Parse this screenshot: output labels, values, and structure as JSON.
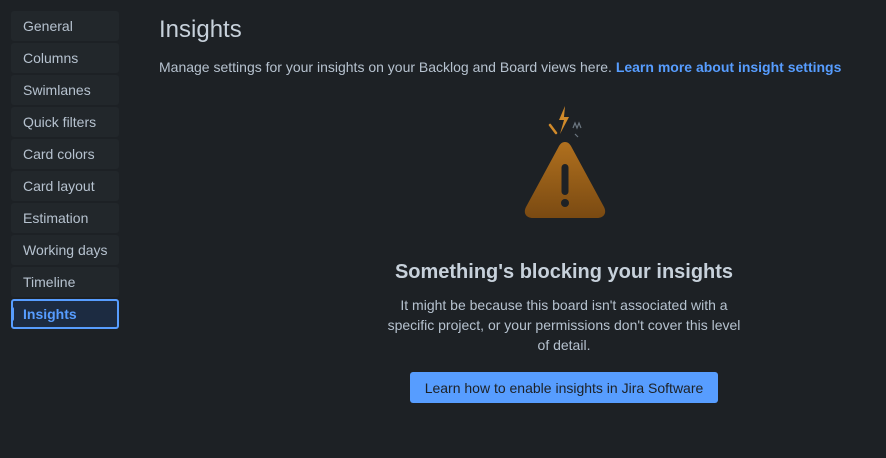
{
  "sidebar": {
    "items": [
      {
        "label": "General"
      },
      {
        "label": "Columns"
      },
      {
        "label": "Swimlanes"
      },
      {
        "label": "Quick filters"
      },
      {
        "label": "Card colors"
      },
      {
        "label": "Card layout"
      },
      {
        "label": "Estimation"
      },
      {
        "label": "Working days"
      },
      {
        "label": "Timeline"
      },
      {
        "label": "Insights"
      }
    ],
    "active": "Insights"
  },
  "header": {
    "title": "Insights",
    "description": "Manage settings for your insights on your Backlog and Board views here.",
    "link_label": "Learn more about insight settings"
  },
  "empty_state": {
    "icon": "warning-icon",
    "title": "Something's blocking your insights",
    "body": "It might be because this board isn't associated with a specific project, or your permissions don't cover this level of detail.",
    "button_label": "Learn how to enable insights in Jira Software"
  },
  "colors": {
    "background": "#1d2125",
    "accent": "#579dff",
    "warning": "#a5681c"
  }
}
